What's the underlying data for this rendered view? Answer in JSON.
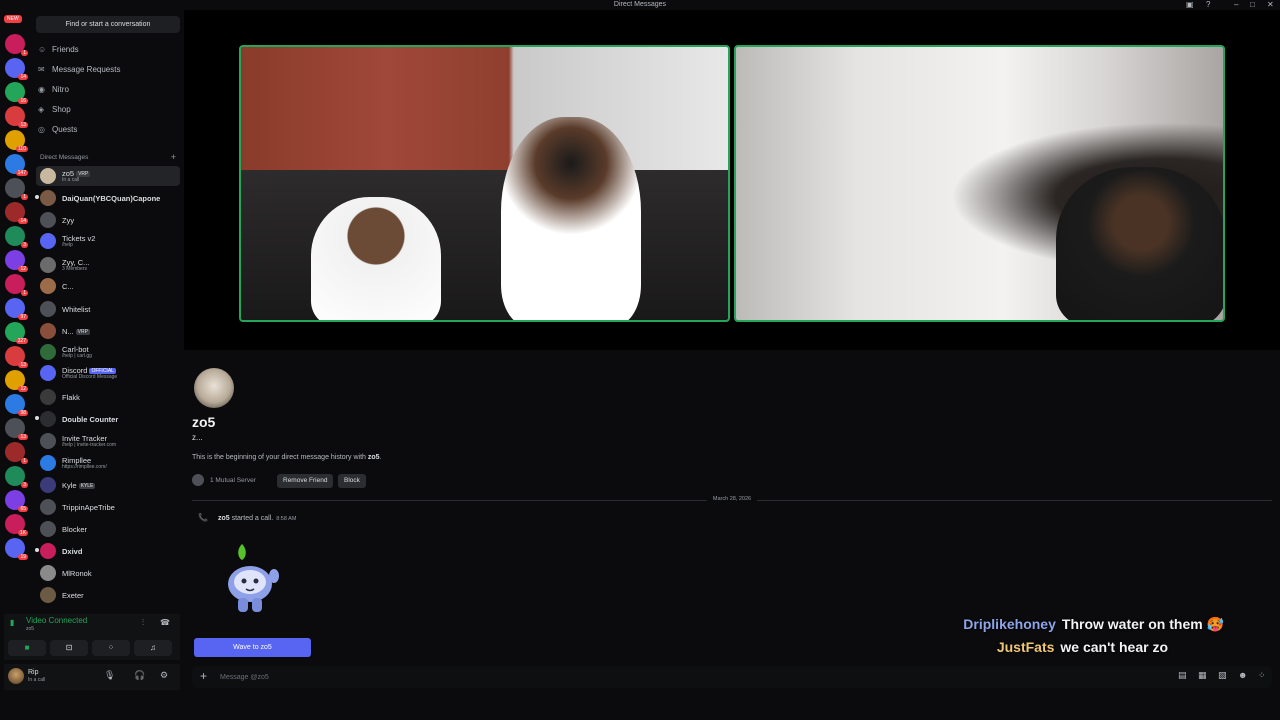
{
  "window": {
    "title": "Direct Messages"
  },
  "rail": {
    "new_label": "NEW",
    "badges": [
      "1",
      "14",
      "16",
      "13",
      "110",
      "147",
      "1",
      "14",
      "3",
      "12",
      "1",
      "97",
      "327",
      "13",
      "12",
      "98",
      "13",
      "1",
      "3",
      "65",
      "1K",
      "19"
    ]
  },
  "sidebar": {
    "search": "Find or start a conversation",
    "nav": [
      {
        "label": "Friends",
        "icon": "friends-icon"
      },
      {
        "label": "Message Requests",
        "icon": "message-requests-icon"
      },
      {
        "label": "Nitro",
        "icon": "nitro-icon"
      },
      {
        "label": "Shop",
        "icon": "shop-icon"
      },
      {
        "label": "Quests",
        "icon": "quests-icon"
      }
    ],
    "dm_header": "Direct Messages",
    "dms": [
      {
        "name": "zo5",
        "sub": "In a call",
        "tag": "VRP",
        "active": true
      },
      {
        "name": "DaiQuan(YBCQuan)Capone",
        "bold": true
      },
      {
        "name": "Zyy"
      },
      {
        "name": "Tickets v2",
        "sub": "/help"
      },
      {
        "name": "Zyy, C...",
        "sub": "3 Members"
      },
      {
        "name": "C..."
      },
      {
        "name": "Whitelist"
      },
      {
        "name": "N...",
        "tag": "VRP"
      },
      {
        "name": "Carl-bot",
        "sub": "/help | carl.gg",
        "bold_name": true
      },
      {
        "name": "Discord",
        "sub": "Official Discord Message",
        "tag": "OFFICIAL",
        "tagtype": "off"
      },
      {
        "name": "Flakk"
      },
      {
        "name": "Double Counter",
        "bold": true
      },
      {
        "name": "Invite Tracker",
        "sub": "/help | invite-tracker.com"
      },
      {
        "name": "Rimpllee",
        "sub": "https://rimpllee.com/"
      },
      {
        "name": "Kyle",
        "tag": "KYLE"
      },
      {
        "name": "TrippinApeTribe"
      },
      {
        "name": "Blocker"
      },
      {
        "name": "Dxivd",
        "bold": true
      },
      {
        "name": "MlRonok"
      },
      {
        "name": "Exeter"
      }
    ],
    "voice": {
      "status": "Video Connected",
      "sub": "zo5"
    },
    "user": {
      "name": "Rip",
      "status": "In a call"
    }
  },
  "chat": {
    "name": "zo5",
    "handle": "z...",
    "intro_prefix": "This is the beginning of your direct message history with ",
    "intro_name": "zo5",
    "intro_suffix": ".",
    "mutual": "1 Mutual Server",
    "remove_friend": "Remove Friend",
    "block": "Block",
    "date": "March 28, 2026",
    "call_user": "zo5",
    "call_text": " started a call.",
    "call_time": "8:58 AM",
    "wave_button": "Wave to zo5",
    "composer_placeholder": "Message @zo5"
  },
  "overlay": [
    {
      "user": "Driplikehoney",
      "text": "Throw water on them 🥵"
    },
    {
      "user": "JustFats",
      "text": "we can't hear zo"
    }
  ],
  "colors": {
    "accent": "#5865f2",
    "online": "#23a55a",
    "danger": "#f23f43"
  }
}
